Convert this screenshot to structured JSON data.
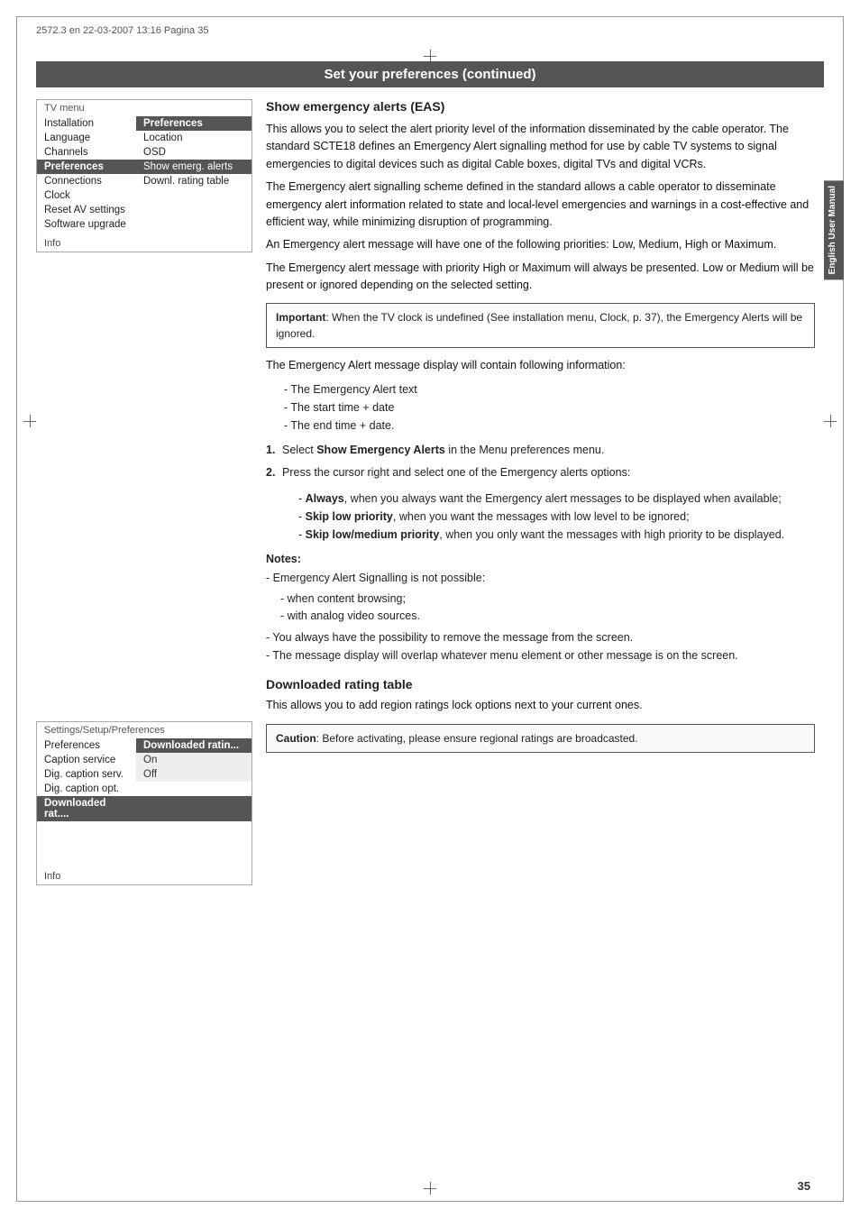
{
  "page": {
    "meta": "2572.3 en  22-03-2007  13:16  Pagina 35",
    "title": "Set your preferences (continued)",
    "page_number": "35",
    "english_tab": "English\nUser Manual"
  },
  "tv_menu": {
    "header": "TV menu",
    "rows": [
      {
        "left": "Installation",
        "right": "Preferences",
        "state": "selected-right"
      },
      {
        "left": "Language",
        "right": "Location",
        "state": ""
      },
      {
        "left": "Channels",
        "right": "OSD",
        "state": ""
      },
      {
        "left": "Preferences",
        "right": "Show emerg. alerts",
        "state": "highlighted"
      },
      {
        "left": "Connections",
        "right": "Downl. rating table",
        "state": ""
      },
      {
        "left": "Clock",
        "right": "",
        "state": ""
      },
      {
        "left": "Reset AV settings",
        "right": "",
        "state": ""
      },
      {
        "left": "Software upgrade",
        "right": "",
        "state": ""
      },
      {
        "left": "",
        "right": "",
        "state": "separator"
      },
      {
        "left": "Info",
        "right": "",
        "state": "info"
      }
    ]
  },
  "settings_menu": {
    "header": "Settings/Setup/Preferences",
    "rows": [
      {
        "left": "Preferences",
        "right": "Downloaded ratin...",
        "state": "selected-right"
      },
      {
        "left": "Caption service",
        "right": "On",
        "state": ""
      },
      {
        "left": "Dig. caption serv.",
        "right": "Off",
        "state": ""
      },
      {
        "left": "Dig. caption opt.",
        "right": "",
        "state": ""
      },
      {
        "left": "Downloaded rat....",
        "right": "",
        "state": "highlighted-left"
      },
      {
        "left": "",
        "right": "",
        "state": "separator"
      },
      {
        "left": "",
        "right": "",
        "state": "separator"
      },
      {
        "left": "",
        "right": "",
        "state": "separator"
      },
      {
        "left": "Info",
        "right": "",
        "state": "info"
      }
    ]
  },
  "section1": {
    "title": "Show emergency alerts (EAS)",
    "paragraphs": [
      "This allows you to select the alert priority level of the information disseminated by the cable operator. The standard SCTE18 defines an Emergency Alert signalling method for use by cable TV systems to signal emergencies to digital devices such as digital Cable boxes, digital TVs and digital VCRs.",
      "The Emergency alert signalling scheme defined in the standard allows a cable operator to disseminate emergency alert information related to state and local-level emergencies and warnings in a cost-effective and efficient way, while minimizing disruption of programming.",
      "An Emergency alert message will have one of the following priorities: Low, Medium, High or Maximum.",
      "The Emergency alert message with priority High or Maximum will always be presented. Low or Medium will be present or ignored depending on the selected setting."
    ],
    "important": "Important: When the TV clock is undefined (See installation menu, Clock, p. 37), the Emergency Alerts will be ignored.",
    "info_intro": "The Emergency Alert message display will contain following information:",
    "info_bullets": [
      "The Emergency Alert text",
      "The start time + date",
      "The end time + date."
    ],
    "steps": [
      {
        "number": "1.",
        "text": "Select Show Emergency Alerts in the Menu preferences menu."
      },
      {
        "number": "2.",
        "text": "Press the cursor right and select one of the Emergency alerts options:"
      }
    ],
    "options": [
      {
        "label": "Always",
        "desc": ", when you always want the Emergency alert messages to be displayed when available;"
      },
      {
        "label": "Skip low priority",
        "desc": ", when you want the messages with low level to be ignored;"
      },
      {
        "label": "Skip low/medium priority",
        "desc": ", when you only want the messages with high priority to be displayed."
      }
    ],
    "notes_title": "Notes:",
    "notes": [
      "Emergency Alert Signalling is not possible:",
      "- when content browsing;",
      "- with analog video sources.",
      "You always have the possibility to remove the message from the screen.",
      "The message display will overlap whatever menu element or other message is on the screen."
    ]
  },
  "section2": {
    "title": "Downloaded rating table",
    "paragraph": "This allows you to add region ratings lock options next to your current ones.",
    "caution": "Caution: Before activating, please ensure regional ratings are broadcasted."
  }
}
